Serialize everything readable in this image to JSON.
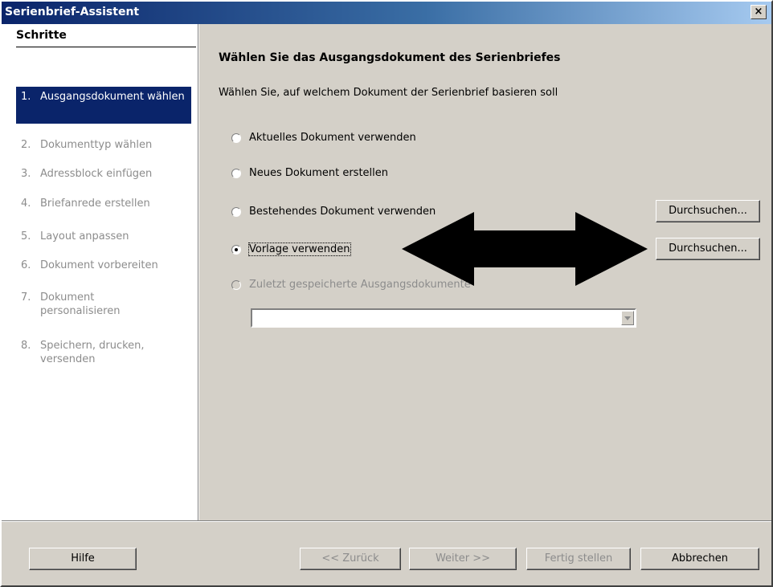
{
  "window": {
    "title": "Serienbrief-Assistent",
    "close_label": "×"
  },
  "steps": {
    "title": "Schritte",
    "items": [
      {
        "num": "1.",
        "label": "Ausgangsdokument wählen"
      },
      {
        "num": "2.",
        "label": "Dokumenttyp wählen"
      },
      {
        "num": "3.",
        "label": "Adressblock einfügen"
      },
      {
        "num": "4.",
        "label": "Briefanrede erstellen"
      },
      {
        "num": "5.",
        "label": "Layout anpassen"
      },
      {
        "num": "6.",
        "label": "Dokument vorbereiten"
      },
      {
        "num": "7.",
        "label": "Dokument personalisieren"
      },
      {
        "num": "8.",
        "label": "Speichern, drucken, versenden"
      }
    ]
  },
  "main": {
    "heading": "Wählen Sie das Ausgangsdokument des Serienbriefes",
    "subtext": "Wählen Sie, auf welchem Dokument der Serienbrief basieren soll",
    "options": [
      {
        "label": "Aktuelles Dokument verwenden",
        "checked": false
      },
      {
        "label": "Neues Dokument erstellen",
        "checked": false
      },
      {
        "label": "Bestehendes Dokument verwenden",
        "checked": false
      },
      {
        "label": "Vorlage verwenden",
        "checked": true
      },
      {
        "label": "Zuletzt gespeicherte Ausgangsdokumente",
        "checked": false,
        "disabled": true
      }
    ],
    "browse_label_1": "Durchsuchen...",
    "browse_label_2": "Durchsuchen...",
    "recent_combo_value": ""
  },
  "footer": {
    "help": "Hilfe",
    "back": "<< Zurück",
    "next": "Weiter >>",
    "finish": "Fertig stellen",
    "cancel": "Abbrechen"
  },
  "colors": {
    "selection": "#0a246a",
    "dialog_bg": "#d4d0c8",
    "disabled_text": "#8c8c8c"
  }
}
